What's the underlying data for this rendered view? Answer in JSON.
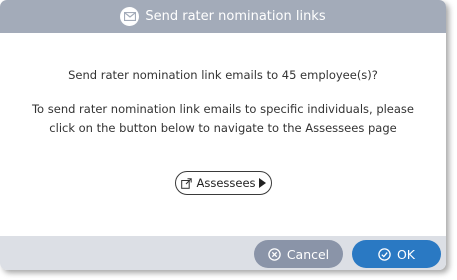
{
  "dialog": {
    "title": "Send rater nomination links",
    "title_icon": "envelope-icon",
    "message_count": "Send rater nomination link emails to 45 employee(s)?",
    "message_instructions": "To send rater nomination link emails to specific individuals, please click on the button below to navigate to the Assessees page",
    "assessees_button": {
      "label": "Assessees",
      "icon": "external-link-icon",
      "trailing_icon": "play-icon"
    }
  },
  "footer": {
    "cancel_label": "Cancel",
    "cancel_icon": "x-circle-icon",
    "ok_label": "OK",
    "ok_icon": "check-circle-icon"
  },
  "colors": {
    "titlebar": "#a3abb9",
    "footer": "#dcdfe5",
    "cancel": "#8a94a8",
    "ok": "#2a79c3"
  }
}
